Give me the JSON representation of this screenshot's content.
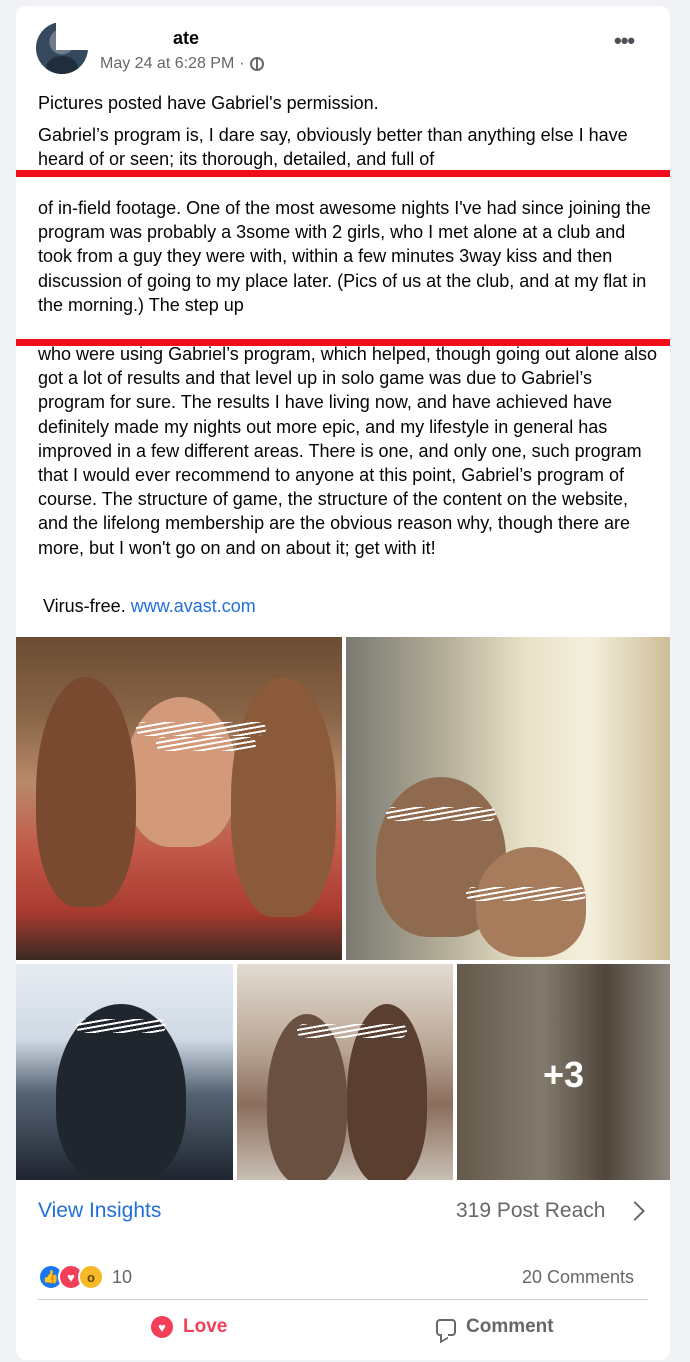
{
  "post": {
    "author_visible": "ate",
    "timestamp": "May 24 at 6:28 PM",
    "meta_separator": "·",
    "privacy_icon": "friends-icon",
    "more_icon": "•••"
  },
  "body": {
    "permission_line": "Pictures posted have Gabriel's permission.",
    "paragraph_start": "Gabriel’s program is, I dare say, obviously better than anything else I have heard of or seen; its thorough, detailed, and full of",
    "highlighted_text": "of in-field footage. One of the most awesome nights I've had since joining the program was probably a 3some with 2 girls, who I met alone at a club and took from a guy they were with, within a few minutes 3way kiss and then discussion of going to my place later. (Pics of us at the club, and at my flat in the morning.)  The step up",
    "paragraph_end": "who were using Gabriel’s program, which helped, though going out alone also got a lot of results and that level up in solo game was due to Gabriel’s program for sure. The results I have living now, and have achieved have definitely made my nights out more epic, and my lifestyle in general has improved in a few different areas. There is one, and only one, such program that I would ever recommend to anyone at this point, Gabriel’s program of course. The structure of game, the structure of the content on the website, and the lifelong membership are the obvious reason why, though there are more, but I won't go on and on about it; get with it!",
    "virus_label": "Virus-free.",
    "virus_link": "www.avast.com"
  },
  "photos": {
    "more_count": "+3"
  },
  "insights": {
    "view_label": "View Insights",
    "reach_label": "319 Post Reach"
  },
  "engagement": {
    "reaction_icons": [
      "like-icon",
      "love-icon",
      "wow-icon"
    ],
    "reaction_count": "10",
    "comments_label": "20 Comments"
  },
  "actions": {
    "love_label": "Love",
    "comment_label": "Comment"
  },
  "colors": {
    "highlight_border": "#f20d1a",
    "link": "#216fdb",
    "love": "#f33e58",
    "like": "#1877f2"
  }
}
